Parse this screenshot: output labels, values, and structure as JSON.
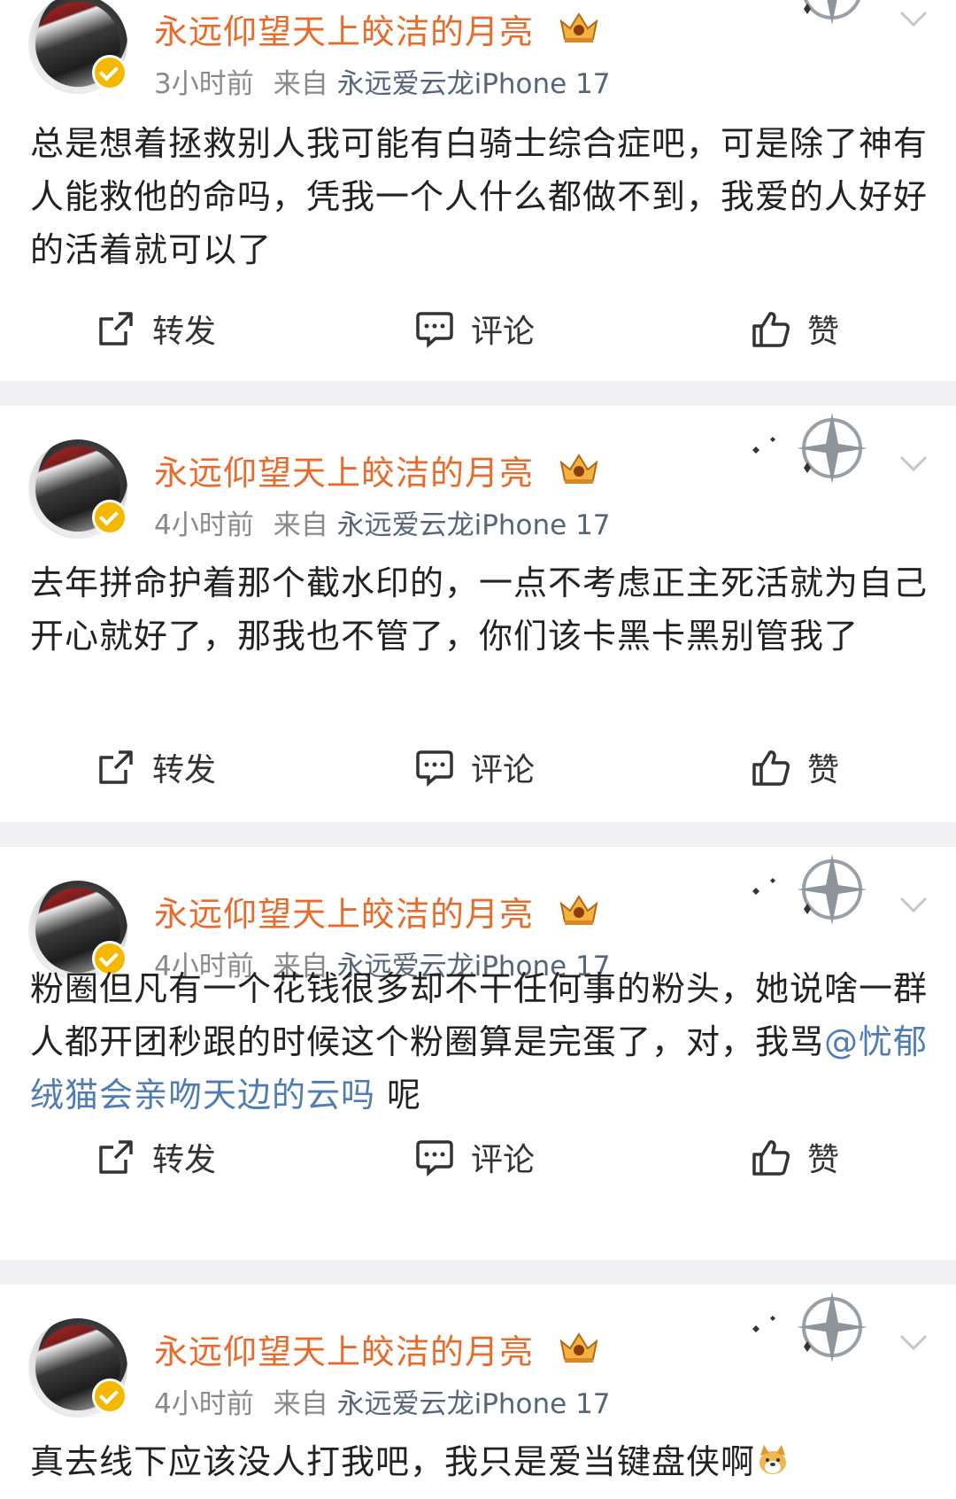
{
  "posts": [
    {
      "author": "永远仰望天上皎洁的月亮",
      "time": "3小时前",
      "from_label": "来自",
      "device": "永远爱云龙iPhone 17",
      "content": "总是想着拯救别人我可能有白骑士综合症吧，可是除了神有人能救他的命吗，凭我一个人什么都做不到，我爱的人好好的活着就可以了"
    },
    {
      "author": "永远仰望天上皎洁的月亮",
      "time": "4小时前",
      "from_label": "来自",
      "device": "永远爱云龙iPhone 17",
      "content": "去年拼命护着那个截水印的，一点不考虑正主死活就为自己开心就好了，那我也不管了，你们该卡黑卡黑别管我了"
    },
    {
      "author": "永远仰望天上皎洁的月亮",
      "time": "4小时前",
      "from_label": "来自",
      "device": "永远爱云龙iPhone 17",
      "content_before": "粉圈但凡有一个花钱很多却不干任何事的粉头，她说啥一群人都开团秒跟的时候这个粉圈算是完蛋了，对，我骂",
      "mention": "@忧郁绒猫会亲吻天边的云吗",
      "content_after": " 呢"
    },
    {
      "author": "永远仰望天上皎洁的月亮",
      "time": "4小时前",
      "from_label": "来自",
      "device": "永远爱云龙iPhone 17",
      "content": "真去线下应该没人打我吧，我只是爱当键盘侠啊",
      "emoji": "dog-face-emoji"
    }
  ],
  "actions": {
    "repost": "转发",
    "comment": "评论",
    "like": "赞"
  },
  "colors": {
    "author": "#e86b2b",
    "meta": "#8a8a8a",
    "device": "#56657c",
    "mention": "#4f7cb3",
    "separator": "#f1f1f3",
    "verified": "#f5b800"
  }
}
